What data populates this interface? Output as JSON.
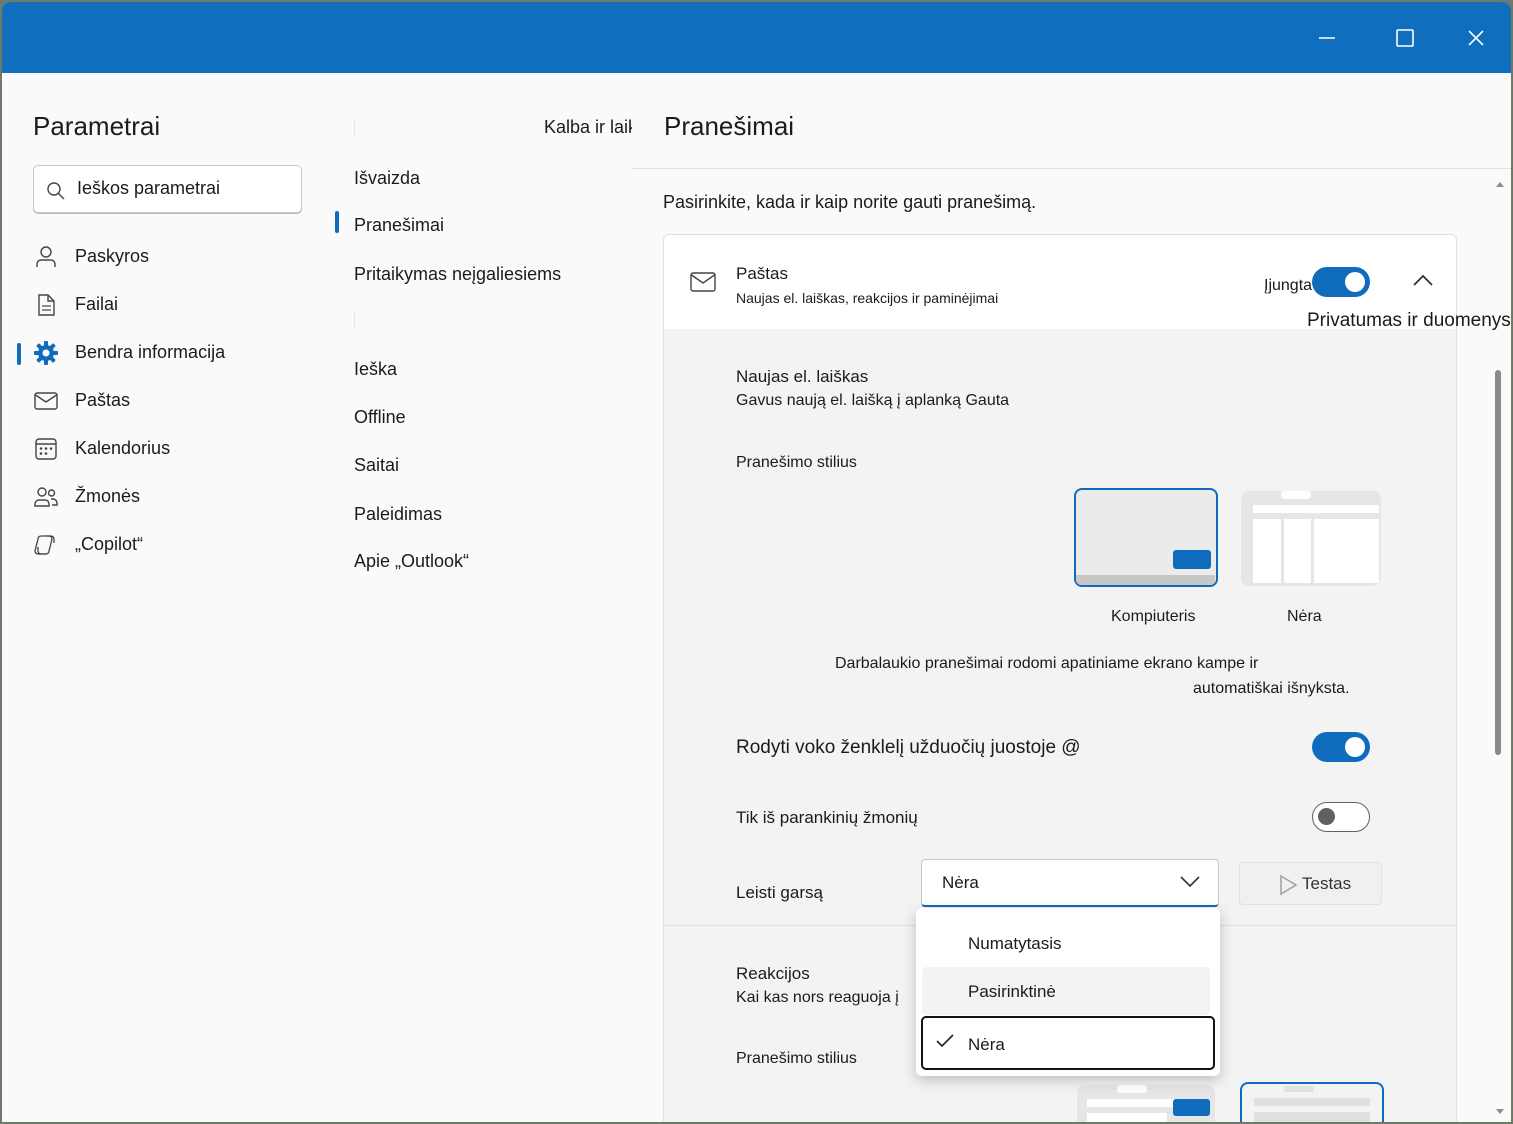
{
  "window": {
    "minimize_icon": "minimize-icon",
    "maximize_icon": "maximize-icon",
    "close_icon": "close-icon"
  },
  "sidebar": {
    "title": "Parametrai",
    "search": {
      "placeholder": "Ieškos parametrai"
    },
    "items": [
      {
        "label": "Paskyros",
        "icon": "person-icon"
      },
      {
        "label": "Failai",
        "icon": "document-icon"
      },
      {
        "label": "Bendra informacija",
        "icon": "gear-icon",
        "selected": true
      },
      {
        "label": "Paštas",
        "icon": "mail-icon"
      },
      {
        "label": "Kalendorius",
        "icon": "calendar-icon"
      },
      {
        "label": "Žmonės",
        "icon": "people-icon"
      },
      {
        "label": "„Copilot“",
        "icon": "copilot-icon"
      }
    ]
  },
  "subnav": {
    "items": [
      {
        "label": "Išvaizda"
      },
      {
        "label": "Pranešimai",
        "selected": true
      },
      {
        "label": "Pritaikymas neįgaliesiems"
      },
      {
        "label": "Ieška"
      },
      {
        "label": "Offline"
      },
      {
        "label": "Saitai"
      },
      {
        "label": "Paleidimas"
      },
      {
        "label": "Apie „Outlook“"
      }
    ],
    "overflow_label": "Kalba ir laikas"
  },
  "main": {
    "title": "Pranešimai",
    "intro": "Pasirinkite, kada ir kaip norite gauti pranešimą.",
    "mail_section": {
      "title": "Paštas",
      "subtitle": "Naujas el. laiškas, reakcijos ir paminėjimai",
      "toggle_label": "Įjungta",
      "toggle_on": true,
      "overflow_label": "Privatumas ir duomenys"
    },
    "new_mail": {
      "title": "Naujas el. laiškas",
      "subtitle": "Gavus naują el. laišką į aplanką Gauta",
      "style_label": "Pranešimo stilius",
      "options": [
        {
          "label": "Kompiuteris",
          "selected": true
        },
        {
          "label": "Nėra",
          "selected": false
        }
      ],
      "desc_line1": "Darbalaukio pranešimai rodomi apatiniame ekrano kampe ir",
      "desc_line2": "automatiškai išnyksta.",
      "badge_label": "Rodyti voko ženklelį užduočių juostoje @",
      "badge_on": true,
      "favorites_label": "Tik iš parankinių žmonių",
      "favorites_on": false,
      "sound_label": "Leisti garsą",
      "sound_value": "Nėra",
      "test_label": "Testas"
    },
    "sound_options": [
      {
        "label": "Numatytasis",
        "checked": false
      },
      {
        "label": "Pasirinktinė",
        "checked": false
      },
      {
        "label": "Nėra",
        "checked": true
      }
    ],
    "reactions": {
      "title": "Reakcijos",
      "subtitle": "Kai kas nors reaguoja į",
      "style_label": "Pranešimo stilius"
    }
  },
  "colors": {
    "accent": "#0f6cbd",
    "titlebar": "#106ebe"
  }
}
